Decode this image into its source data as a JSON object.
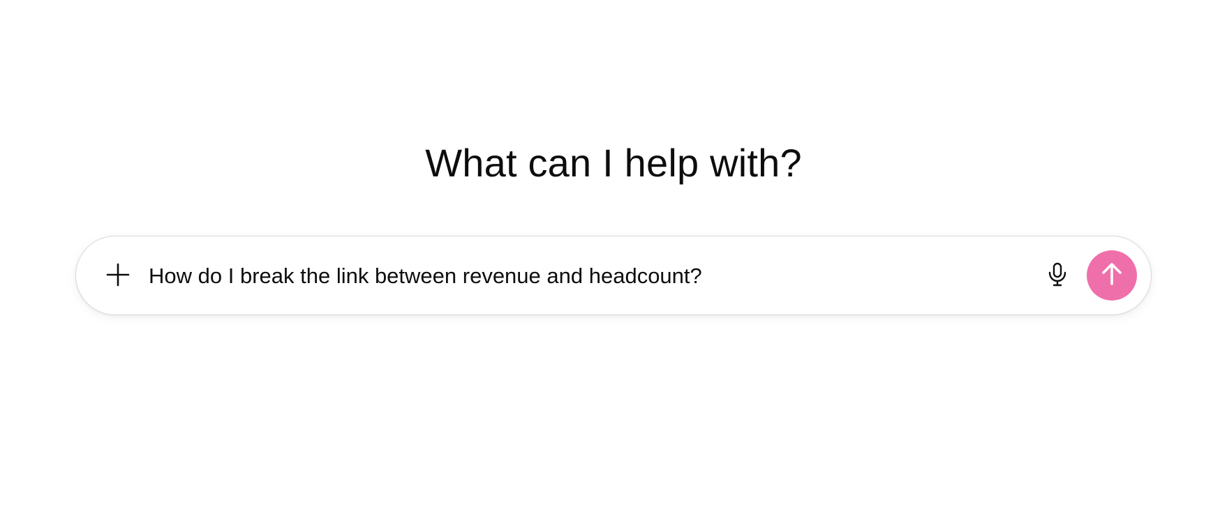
{
  "heading": "What can I help with?",
  "composer": {
    "value": "How do I break the link between revenue and headcount?",
    "icons": {
      "attach": "plus-icon",
      "voice": "microphone-icon",
      "send": "arrow-up-icon"
    },
    "send_color": "#ef6faa",
    "icon_color": "#0d0d0d"
  }
}
